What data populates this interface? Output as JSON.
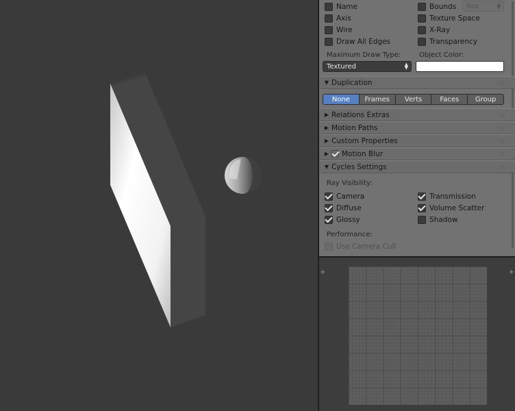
{
  "display": {
    "checks": [
      {
        "label": "Name",
        "checked": false
      },
      {
        "label": "Axis",
        "checked": false
      },
      {
        "label": "Wire",
        "checked": false
      },
      {
        "label": "Draw All Edges",
        "checked": false
      }
    ],
    "checks_right": [
      {
        "label": "Bounds",
        "checked": false
      },
      {
        "label": "Texture Space",
        "checked": false
      },
      {
        "label": "X-Ray",
        "checked": false
      },
      {
        "label": "Transparency",
        "checked": false
      }
    ],
    "bounds_type": "Box",
    "max_draw_type_label": "Maximum Draw Type:",
    "max_draw_type_value": "Textured",
    "object_color_label": "Object Color:",
    "object_color": "#ffffff"
  },
  "duplication": {
    "title": "Duplication",
    "options": [
      "None",
      "Frames",
      "Verts",
      "Faces",
      "Group"
    ],
    "selected": "None"
  },
  "panels": {
    "relations_extras": "Relations Extras",
    "motion_paths": "Motion Paths",
    "custom_properties": "Custom Properties",
    "motion_blur": "Motion Blur",
    "motion_blur_enabled": true,
    "cycles_settings": "Cycles Settings"
  },
  "cycles": {
    "ray_visibility_label": "Ray Visibility:",
    "left": [
      {
        "label": "Camera",
        "checked": true
      },
      {
        "label": "Diffuse",
        "checked": true
      },
      {
        "label": "Glossy",
        "checked": true
      }
    ],
    "right": [
      {
        "label": "Transmission",
        "checked": true
      },
      {
        "label": "Volume Scatter",
        "checked": true
      },
      {
        "label": "Shadow",
        "checked": false
      }
    ],
    "performance_label": "Performance:",
    "use_camera_cull": "Use Camera Cull",
    "use_camera_cull_checked": false
  },
  "colors": {
    "accent": "#5680c2",
    "panel_bg": "#727272",
    "viewport_bg": "#3a3a3a"
  }
}
